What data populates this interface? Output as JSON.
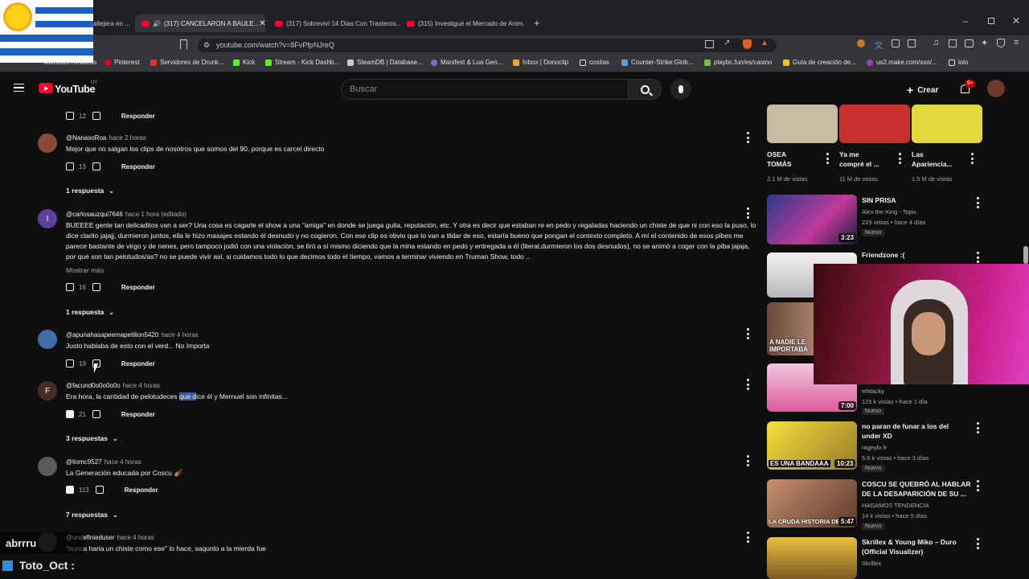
{
  "browser": {
    "tabs": [
      {
        "label": "allejera en ..."
      },
      {
        "label": "(317) CANCELARON A BAULE..."
      },
      {
        "label": "(317) Sobreviví 14 Días Con Trasteros..."
      },
      {
        "label": "(315) Investigué el Mercado de Anim..."
      }
    ],
    "url": "youtube.com/watch?v=8FvPfpNJreQ",
    "bookmarks": [
      "Microsoft Rewards",
      "Pinterest",
      "Servidores de Drunk...",
      "Kick",
      "Stream - Kick Dashb...",
      "SteamDB | Database...",
      "Manifest & Lua Gen...",
      "Inbox | Donoclip",
      "cositas",
      "Counter-Strike:Glob...",
      "playbc.fun/es/casino",
      "Guía de creación de...",
      "us2.make.com/sso/...",
      "lolo"
    ]
  },
  "header": {
    "logo_text": "YouTube",
    "region": "UY",
    "search_placeholder": "Buscar",
    "create_label": "Crear",
    "notif_count": "9+"
  },
  "comments": {
    "top_likes": "12",
    "reply_label": "Responder",
    "items": [
      {
        "author": "@NanasoRoa",
        "time": "hace 2 horas",
        "text": "Mejor que no salgan los clips de nosotros que somos del 90, porque es carcel directo",
        "likes": "13",
        "replies": "1 respuesta"
      },
      {
        "author": "@carlosauzqui7646",
        "time": "hace 1 hora (editado)",
        "avatar_letter": "I",
        "text": "BUEEEE gente tan delicaditos van a ser? Una cosa es cagarle el show a una \"amiga\" en donde se juega guita, reputación, etc. Y otra es decir que estaban re en pedo y regaladas haciendo un chiste de que ni con eso la puso, lo dice clarito jajajj, durmieron juntos, ella le hizo masajes estando él desnudo y no cogieron. Con ese clip es obvio que lo van a tildar de eso, estaría bueno que pongan el contexto completo. A mí el contenido de esos pibes me parece bastante de virgo y de nenes, pero tampoco jodió con una violación, se tiró a sí mismo diciendo que la mina estando en pedo y entregada a él (literal,durmieron los dos desnudos), no se animó a coger con la piba jajaja, por qué son tan pelotudos/as? no se puede vivir así, si cuidamos todo lo que decimos todo el tiempo, vamos a terminar viviendo en Truman Show, todo ..",
        "more": "Mostrar más",
        "likes": "16",
        "replies": "1 respuesta"
      },
      {
        "author": "@apunahasapeemapetilion5420",
        "time": "hace 4 horas",
        "text": "Justo hablaba de esto con el verd... No Importa",
        "likes": "19"
      },
      {
        "author": "@facund0o0o0o0o",
        "time": "hace 4 horas",
        "avatar_letter": "F",
        "text_a": "Era hora, la cantidad de pelotudeces ",
        "text_hl": "que d",
        "text_b": "ice él y Mernuel son infinitas...",
        "likes": "21",
        "replies": "3 respuestas"
      },
      {
        "author": "@liomc9527",
        "time": "hace 4 horas",
        "text": "La Generación educada por Coscu 🎻",
        "likes": "113",
        "replies": "7 respuestas"
      },
      {
        "author": "@undefinieduser",
        "time": "hace 4 horas",
        "text": "\"nunca haria un chiste como ese\" lo hace, saqunlo a la mierda fue"
      }
    ]
  },
  "overlay": {
    "chat_line1": "abrrru",
    "chat_line2": "Toto_Oct :"
  },
  "sidebar": {
    "top_row": [
      {
        "title_1": "OSEA",
        "title_2": "TOMÁS",
        "views": "2.1 M de vistas"
      },
      {
        "title_1": "Ya me",
        "title_2": "compré el ...",
        "views": "11 M de vistas"
      },
      {
        "title_1": "Las",
        "title_2": "Apariencia...",
        "views": "1.5 M de vistas"
      }
    ],
    "videos": [
      {
        "title": "SIN PRISA",
        "channel": "Alex the King - Topic",
        "meta": "223 vistas • hace 4 días",
        "badge": "Nuevo",
        "duration": "3:23"
      },
      {
        "title": "Friendzone :(",
        "channel": "",
        "meta": "",
        "thumb_text": ""
      },
      {
        "title": "",
        "channel": "",
        "meta": "",
        "thumb_text": "A NADIE LE IMPORTABA"
      },
      {
        "title": "",
        "channel": "elWacky",
        "meta": "125 k vistas • hace 1 día",
        "badge": "Nuevo",
        "duration": "7:00"
      },
      {
        "title_1": "no paran de funar a los del",
        "title_2": "under XD",
        "channel": "rageylo fr",
        "meta": "5.6 k vistas • hace 3 días",
        "badge": "Nuevo",
        "duration": "10:23",
        "thumb_text": "ES UNA BANDAAA"
      },
      {
        "title_1": "COSCU SE QUEBRÓ AL HABLAR",
        "title_2": "DE LA DESAPARICIÓN DE SU ...",
        "channel": "HAGAMOS TENDENCIA",
        "meta": "14 k vistas • hace 5 días",
        "badge": "Nuevo",
        "duration": "5:47",
        "thumb_text": "LA CRUDA HISTORIA DE"
      },
      {
        "title_1": "Skrillex & Young Miko – Duro",
        "title_2": "(Official Visualizer)",
        "channel": "Skrillex"
      }
    ]
  }
}
